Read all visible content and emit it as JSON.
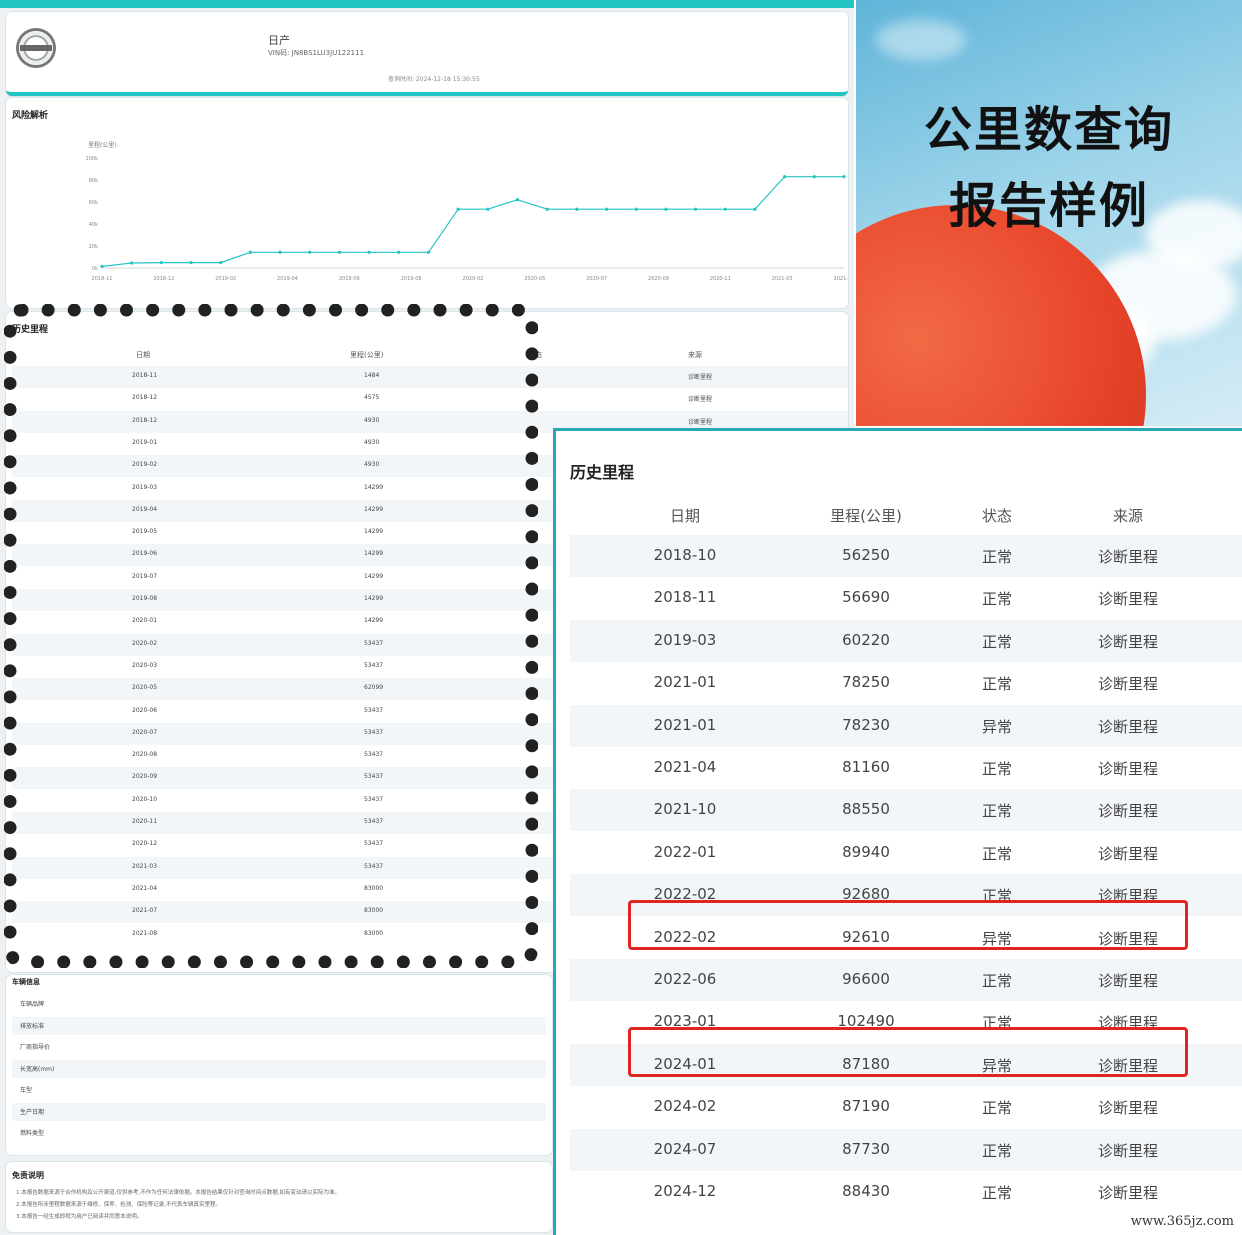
{
  "report": {
    "brand": "日产",
    "vin": "VIN码: JN8BS1LU3JU122111",
    "query_time": "查询时间: 2024-12-18 15:30:55",
    "risk_title": "风险解析",
    "chart_ylabel": "里程(公里)",
    "history_title": "历史里程",
    "history_columns": [
      "日期",
      "里程(公里)",
      "状态",
      "来源"
    ],
    "history_rows": [
      {
        "date": "2018-11",
        "mileage": "1484",
        "source": "诊断里程"
      },
      {
        "date": "2018-12",
        "mileage": "4575",
        "source": "诊断里程"
      },
      {
        "date": "2018-12",
        "mileage": "4930",
        "source": "诊断里程"
      },
      {
        "date": "2019-01",
        "mileage": "4930"
      },
      {
        "date": "2019-02",
        "mileage": "4930"
      },
      {
        "date": "2019-03",
        "mileage": "14299"
      },
      {
        "date": "2019-04",
        "mileage": "14299"
      },
      {
        "date": "2019-05",
        "mileage": "14299"
      },
      {
        "date": "2019-06",
        "mileage": "14299"
      },
      {
        "date": "2019-07",
        "mileage": "14299"
      },
      {
        "date": "2019-08",
        "mileage": "14299"
      },
      {
        "date": "2020-01",
        "mileage": "14299"
      },
      {
        "date": "2020-02",
        "mileage": "53437"
      },
      {
        "date": "2020-03",
        "mileage": "53437"
      },
      {
        "date": "2020-05",
        "mileage": "62099"
      },
      {
        "date": "2020-06",
        "mileage": "53437"
      },
      {
        "date": "2020-07",
        "mileage": "53437"
      },
      {
        "date": "2020-08",
        "mileage": "53437"
      },
      {
        "date": "2020-09",
        "mileage": "53437"
      },
      {
        "date": "2020-10",
        "mileage": "53437"
      },
      {
        "date": "2020-11",
        "mileage": "53437"
      },
      {
        "date": "2020-12",
        "mileage": "53437"
      },
      {
        "date": "2021-03",
        "mileage": "53437"
      },
      {
        "date": "2021-04",
        "mileage": "83000"
      },
      {
        "date": "2021-07",
        "mileage": "83000"
      },
      {
        "date": "2021-08",
        "mileage": "83000"
      }
    ],
    "vehicle_info_title": "车辆信息",
    "vehicle_info_labels": [
      "车辆品牌",
      "排放标准",
      "厂商指导价",
      "长宽高(mm)",
      "车型",
      "生产日期",
      "燃料类型"
    ],
    "disclaimer_title": "免责说明",
    "disclaimer_lines": [
      "1.本报告数据来源于合作机构及公开渠道,仅供参考,不作为任何法律依据。本报告结果仅针对查询时间点数据,如有变动请以实际为准。",
      "2.本报告所涉里程数据来源于维修、保养、检测、保险等记录,不代表车辆真实里程。",
      "3.本报告一经生成即视为用户已阅读并同意本说明。"
    ]
  },
  "chart_data": {
    "type": "line",
    "title": "",
    "xlabel": "",
    "ylabel": "里程(公里)",
    "y_tick_labels": [
      "0k",
      "20k",
      "40k",
      "60k",
      "80k",
      "100k"
    ],
    "ylim": [
      0,
      100000
    ],
    "x_tick_labels": [
      "2018-11",
      "2018-12",
      "2019-02",
      "2019-04",
      "2019-06",
      "2019-08",
      "2020-02",
      "2020-05",
      "2020-07",
      "2020-09",
      "2020-11",
      "2021-03",
      "2021-07"
    ],
    "series": [
      {
        "values": [
          1484,
          4575,
          4930,
          4930,
          4930,
          14299,
          14299,
          14299,
          14299,
          14299,
          14299,
          14299,
          53437,
          53437,
          62099,
          53437,
          53437,
          53437,
          53437,
          53437,
          53437,
          53437,
          53437,
          83000,
          83000,
          83000
        ]
      }
    ],
    "grid": false,
    "color": "#22c4c4"
  },
  "poster": {
    "title_line1": "公里数查询",
    "title_line2": "报告样例"
  },
  "table": {
    "title": "历史里程",
    "columns": [
      "日期",
      "里程(公里)",
      "状态",
      "来源"
    ],
    "rows": [
      {
        "date": "2018-10",
        "mileage": "56250",
        "status": "正常",
        "source": "诊断里程",
        "highlight": false
      },
      {
        "date": "2018-11",
        "mileage": "56690",
        "status": "正常",
        "source": "诊断里程",
        "highlight": false
      },
      {
        "date": "2019-03",
        "mileage": "60220",
        "status": "正常",
        "source": "诊断里程",
        "highlight": false
      },
      {
        "date": "2021-01",
        "mileage": "78250",
        "status": "正常",
        "source": "诊断里程",
        "highlight": false
      },
      {
        "date": "2021-01",
        "mileage": "78230",
        "status": "异常",
        "source": "诊断里程",
        "highlight": false
      },
      {
        "date": "2021-04",
        "mileage": "81160",
        "status": "正常",
        "source": "诊断里程",
        "highlight": false
      },
      {
        "date": "2021-10",
        "mileage": "88550",
        "status": "正常",
        "source": "诊断里程",
        "highlight": false
      },
      {
        "date": "2022-01",
        "mileage": "89940",
        "status": "正常",
        "source": "诊断里程",
        "highlight": false
      },
      {
        "date": "2022-02",
        "mileage": "92680",
        "status": "正常",
        "source": "诊断里程",
        "highlight": false
      },
      {
        "date": "2022-02",
        "mileage": "92610",
        "status": "异常",
        "source": "诊断里程",
        "highlight": true
      },
      {
        "date": "2022-06",
        "mileage": "96600",
        "status": "正常",
        "source": "诊断里程",
        "highlight": false
      },
      {
        "date": "2023-01",
        "mileage": "102490",
        "status": "正常",
        "source": "诊断里程",
        "highlight": false
      },
      {
        "date": "2024-01",
        "mileage": "87180",
        "status": "异常",
        "source": "诊断里程",
        "highlight": true
      },
      {
        "date": "2024-02",
        "mileage": "87190",
        "status": "正常",
        "source": "诊断里程",
        "highlight": false
      },
      {
        "date": "2024-07",
        "mileage": "87730",
        "status": "正常",
        "source": "诊断里程",
        "highlight": false
      },
      {
        "date": "2024-12",
        "mileage": "88430",
        "status": "正常",
        "source": "诊断里程",
        "highlight": false
      }
    ],
    "highlight_color": "#e0241f"
  },
  "watermark": "www.365jz.com"
}
